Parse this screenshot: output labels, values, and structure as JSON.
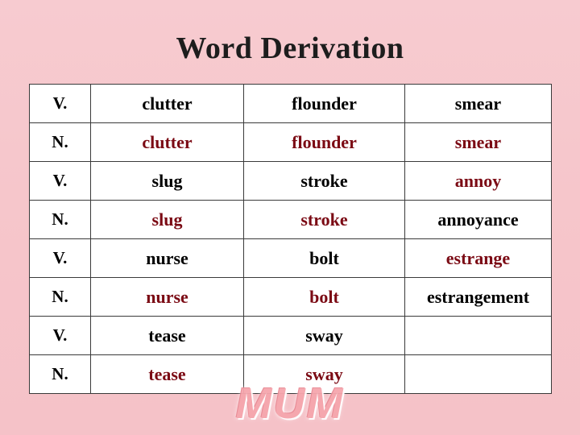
{
  "slide": {
    "title": "Word Derivation",
    "watermark": "MUM",
    "colors": {
      "background": "#f6c6cb",
      "table_background": "#ffffff",
      "border": "#3a3a3a",
      "text_black": "#000000",
      "text_dark_red": "#7b0a14",
      "title": "#1d1d1d",
      "watermark": "#f6a6ad"
    },
    "table": {
      "rows": [
        {
          "pos": "V.",
          "cells": [
            {
              "text": "clutter",
              "color": "#000000"
            },
            {
              "text": "flounder",
              "color": "#000000"
            },
            {
              "text": "smear",
              "color": "#000000"
            }
          ]
        },
        {
          "pos": "N.",
          "cells": [
            {
              "text": "clutter",
              "color": "#7b0a14"
            },
            {
              "text": "flounder",
              "color": "#7b0a14"
            },
            {
              "text": "smear",
              "color": "#7b0a14"
            }
          ]
        },
        {
          "pos": "V.",
          "cells": [
            {
              "text": "slug",
              "color": "#000000"
            },
            {
              "text": "stroke",
              "color": "#000000"
            },
            {
              "text": "annoy",
              "color": "#7b0a14"
            }
          ]
        },
        {
          "pos": "N.",
          "cells": [
            {
              "text": "slug",
              "color": "#7b0a14"
            },
            {
              "text": "stroke",
              "color": "#7b0a14"
            },
            {
              "text": "annoyance",
              "color": "#000000"
            }
          ]
        },
        {
          "pos": "V.",
          "cells": [
            {
              "text": "nurse",
              "color": "#000000"
            },
            {
              "text": "bolt",
              "color": "#000000"
            },
            {
              "text": "estrange",
              "color": "#7b0a14"
            }
          ]
        },
        {
          "pos": "N.",
          "cells": [
            {
              "text": "nurse",
              "color": "#7b0a14"
            },
            {
              "text": "bolt",
              "color": "#7b0a14"
            },
            {
              "text": "estrangement",
              "color": "#000000"
            }
          ]
        },
        {
          "pos": "V.",
          "cells": [
            {
              "text": "tease",
              "color": "#000000"
            },
            {
              "text": "sway",
              "color": "#000000"
            },
            {
              "text": "",
              "color": "#000000"
            }
          ]
        },
        {
          "pos": "N.",
          "cells": [
            {
              "text": "tease",
              "color": "#7b0a14"
            },
            {
              "text": "sway",
              "color": "#7b0a14"
            },
            {
              "text": "",
              "color": "#000000"
            }
          ]
        }
      ]
    }
  }
}
